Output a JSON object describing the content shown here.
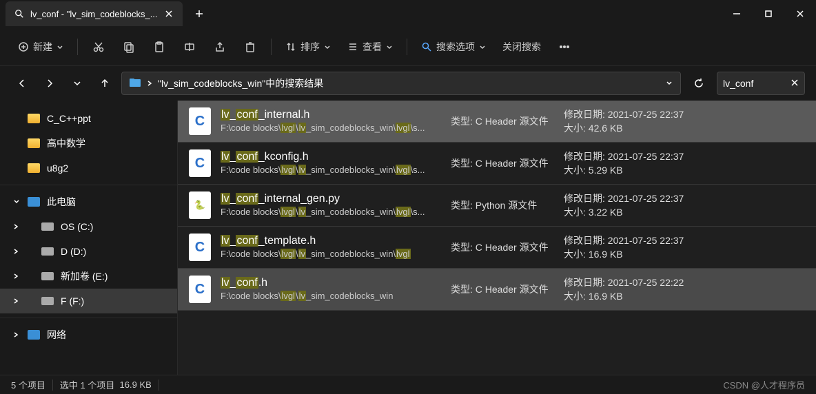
{
  "tab": {
    "title": "lv_conf - \"lv_sim_codeblocks_..."
  },
  "toolbar": {
    "new": "新建",
    "sort": "排序",
    "view": "查看",
    "search_options": "搜索选项",
    "close_search": "关闭搜索"
  },
  "address": {
    "text": "\"lv_sim_codeblocks_win\"中的搜索结果"
  },
  "search": {
    "value": "lv_conf"
  },
  "sidebar": {
    "folders": [
      {
        "label": "C_C++ppt"
      },
      {
        "label": "高中数学"
      },
      {
        "label": "u8g2"
      }
    ],
    "this_pc": "此电脑",
    "drives": [
      {
        "label": "OS (C:)"
      },
      {
        "label": "D (D:)"
      },
      {
        "label": "新加卷 (E:)"
      },
      {
        "label": "F (F:)"
      }
    ],
    "network": "网络"
  },
  "results": [
    {
      "name_pre": "lv",
      "name_mid": "conf",
      "name_post": "_internal.h",
      "path_pre": "F:\\code blocks\\",
      "path_seg1": "lvgl",
      "path_mid1": "\\",
      "path_seg2": "lv",
      "path_mid2": "_sim_codeblocks_win\\",
      "path_seg3": "lvgl",
      "path_post": "\\s...",
      "type_label": "类型:",
      "type": "C Header 源文件",
      "date_label": "修改日期:",
      "date": "2021-07-25 22:37",
      "size_label": "大小:",
      "size": "42.6 KB",
      "icon": "c",
      "selected": true
    },
    {
      "name_pre": "lv",
      "name_mid": "conf",
      "name_post": "_kconfig.h",
      "path_pre": "F:\\code blocks\\",
      "path_seg1": "lvgl",
      "path_mid1": "\\",
      "path_seg2": "lv",
      "path_mid2": "_sim_codeblocks_win\\",
      "path_seg3": "lvgl",
      "path_post": "\\s...",
      "type_label": "类型:",
      "type": "C Header 源文件",
      "date_label": "修改日期:",
      "date": "2021-07-25 22:37",
      "size_label": "大小:",
      "size": "5.29 KB",
      "icon": "c",
      "selected": false
    },
    {
      "name_pre": "lv",
      "name_mid": "conf",
      "name_post": "_internal_gen.py",
      "path_pre": "F:\\code blocks\\",
      "path_seg1": "lvgl",
      "path_mid1": "\\",
      "path_seg2": "lv",
      "path_mid2": "_sim_codeblocks_win\\",
      "path_seg3": "lvgl",
      "path_post": "\\s...",
      "type_label": "类型:",
      "type": "Python 源文件",
      "date_label": "修改日期:",
      "date": "2021-07-25 22:37",
      "size_label": "大小:",
      "size": "3.22 KB",
      "icon": "py",
      "selected": false
    },
    {
      "name_pre": "lv",
      "name_mid": "conf",
      "name_post": "_template.h",
      "path_pre": "F:\\code blocks\\",
      "path_seg1": "lvgl",
      "path_mid1": "\\",
      "path_seg2": "lv",
      "path_mid2": "_sim_codeblocks_win\\",
      "path_seg3": "lvgl",
      "path_post": "",
      "type_label": "类型:",
      "type": "C Header 源文件",
      "date_label": "修改日期:",
      "date": "2021-07-25 22:37",
      "size_label": "大小:",
      "size": "16.9 KB",
      "icon": "c",
      "selected": false
    },
    {
      "name_pre": "lv",
      "name_mid": "conf",
      "name_post": ".h",
      "path_pre": "F:\\code blocks\\",
      "path_seg1": "lvgl",
      "path_mid1": "\\",
      "path_seg2": "lv",
      "path_mid2": "_sim_codeblocks_win",
      "path_seg3": "",
      "path_post": "",
      "type_label": "类型:",
      "type": "C Header 源文件",
      "date_label": "修改日期:",
      "date": "2021-07-25 22:22",
      "size_label": "大小:",
      "size": "16.9 KB",
      "icon": "c",
      "selected": false,
      "highlighted": true
    }
  ],
  "status": {
    "items": "5 个项目",
    "selected": "选中 1 个项目",
    "size": "16.9 KB"
  },
  "watermark": "CSDN @人才程序员"
}
